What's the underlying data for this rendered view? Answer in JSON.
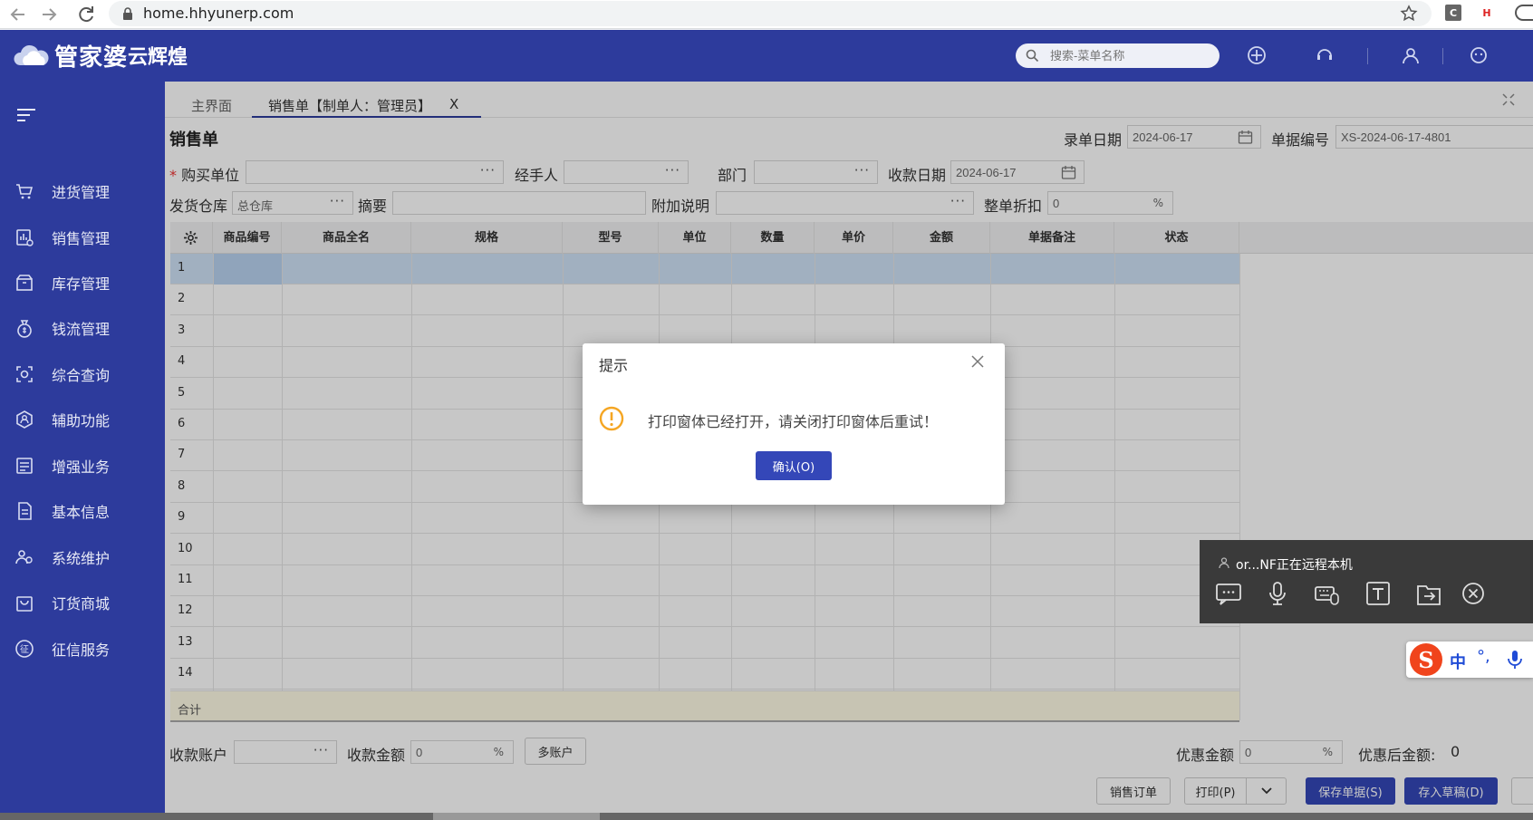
{
  "browser": {
    "url": "home.hhyunerp.com"
  },
  "header": {
    "logo_main": "管家婆",
    "logo_sub": "云辉煌",
    "search_placeholder": "搜索-菜单名称",
    "brand_color": "#2d3b9c"
  },
  "sidebar": {
    "items": [
      {
        "label": "进货管理",
        "icon": "purchase-cart-icon"
      },
      {
        "label": "销售管理",
        "icon": "sales-chart-icon"
      },
      {
        "label": "库存管理",
        "icon": "warehouse-icon"
      },
      {
        "label": "钱流管理",
        "icon": "money-bag-icon"
      },
      {
        "label": "综合查询",
        "icon": "query-scan-icon"
      },
      {
        "label": "辅助功能",
        "icon": "hex-user-icon"
      },
      {
        "label": "增强业务",
        "icon": "list-card-icon"
      },
      {
        "label": "基本信息",
        "icon": "document-icon"
      },
      {
        "label": "系统维护",
        "icon": "users-gear-icon"
      },
      {
        "label": "订货商城",
        "icon": "shop-bag-icon"
      },
      {
        "label": "征信服务",
        "icon": "credit-badge-icon"
      }
    ]
  },
  "tabs": {
    "home": "主界面",
    "sales": "销售单【制单人：管理员】",
    "close": "X"
  },
  "form": {
    "title": "销售单",
    "entry_date_label": "录单日期",
    "entry_date": "2024-06-17",
    "doc_no_label": "单据编号",
    "doc_no": "XS-2024-06-17-4801",
    "required_mark": "*",
    "buyer_label": "购买单位",
    "handler_label": "经手人",
    "dept_label": "部门",
    "receipt_date_label": "收款日期",
    "receipt_date": "2024-06-17",
    "warehouse_label": "发货仓库",
    "warehouse": "总仓库",
    "summary_label": "摘要",
    "note_label": "附加说明",
    "discount_label": "整单折扣",
    "discount": "0",
    "pct": "%",
    "dots": "···"
  },
  "grid": {
    "columns": [
      "商品编号",
      "商品全名",
      "规格",
      "型号",
      "单位",
      "数量",
      "单价",
      "金额",
      "单据备注",
      "状态"
    ],
    "rows": [
      "1",
      "2",
      "3",
      "4",
      "5",
      "6",
      "7",
      "8",
      "9",
      "10",
      "11",
      "12",
      "13",
      "14"
    ],
    "total_label": "合计"
  },
  "footer": {
    "account_label": "收款账户",
    "amount_label": "收款金额",
    "amount": "0",
    "multi_account": "多账户",
    "discount_amount_label": "优惠金额",
    "discount_amount": "0",
    "after_discount_label": "优惠后金额:",
    "after_discount": "0",
    "sales_order_btn": "销售订单",
    "print_btn": "打印(P)",
    "save_btn": "保存单据(S)",
    "draft_btn": "存入草稿(D)"
  },
  "dialog": {
    "title": "提示",
    "message": "打印窗体已经打开，请关闭打印窗体后重试！",
    "ok": "确认(O)"
  },
  "remote": {
    "status": "or...NF正在远程本机"
  },
  "ime": {
    "lang": "中"
  }
}
